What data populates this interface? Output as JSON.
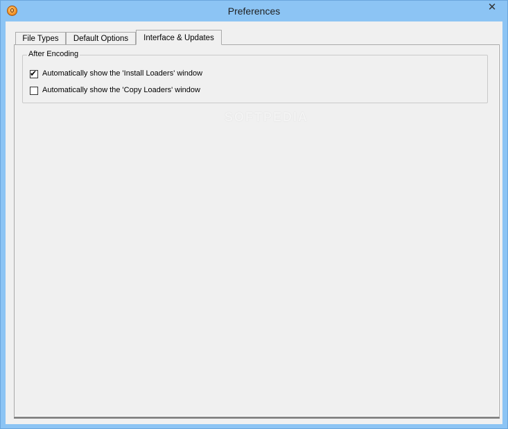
{
  "window": {
    "title": "Preferences",
    "close_symbol": "✕",
    "app_icon": "app-orange-icon"
  },
  "tabs": [
    {
      "label": "File Types",
      "active": false
    },
    {
      "label": "Default Options",
      "active": false
    },
    {
      "label": "Interface & Updates",
      "active": true
    }
  ],
  "group": {
    "legend": "After Encoding",
    "options": [
      {
        "label": "Automatically show the 'Install Loaders' window",
        "checked": true
      },
      {
        "label": "Automatically show the 'Copy Loaders' window",
        "checked": false
      }
    ]
  },
  "watermark": "SOFTPEDIA",
  "colors": {
    "titlebar": "#8cc4f4",
    "client": "#f0f0f0"
  }
}
